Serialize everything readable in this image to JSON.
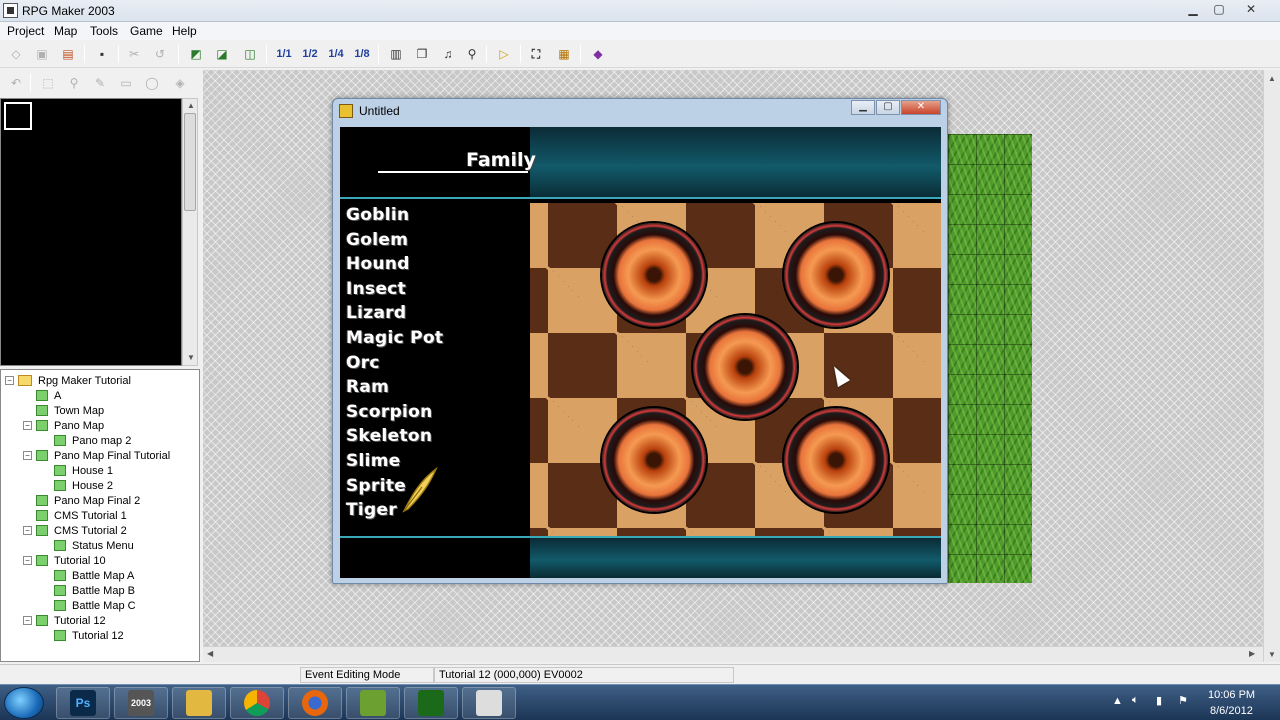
{
  "window": {
    "title": "RPG Maker 2003",
    "minimize": "▁",
    "maximize": "▢",
    "close": "✕"
  },
  "menu": [
    {
      "label": "Project",
      "key": "P"
    },
    {
      "label": "Map",
      "key": "M"
    },
    {
      "label": "Tools",
      "key": "T"
    },
    {
      "label": "Game",
      "key": "G"
    },
    {
      "label": "Help",
      "key": "H"
    }
  ],
  "toolbar": {
    "zoom": [
      "1/1",
      "1/2",
      "1/4",
      "1/8"
    ]
  },
  "map_tree": [
    {
      "label": "Rpg Maker Tutorial",
      "indent": 0,
      "type": "folder",
      "toggle": "−"
    },
    {
      "label": "A",
      "indent": 1,
      "type": "map",
      "toggle": ""
    },
    {
      "label": "Town Map",
      "indent": 1,
      "type": "map",
      "toggle": ""
    },
    {
      "label": "Pano Map",
      "indent": 1,
      "type": "map",
      "toggle": "−"
    },
    {
      "label": "Pano map 2",
      "indent": 2,
      "type": "map",
      "toggle": ""
    },
    {
      "label": "Pano Map Final Tutorial",
      "indent": 1,
      "type": "map",
      "toggle": "−"
    },
    {
      "label": "House 1",
      "indent": 2,
      "type": "map",
      "toggle": ""
    },
    {
      "label": "House 2",
      "indent": 2,
      "type": "map",
      "toggle": ""
    },
    {
      "label": "Pano Map Final 2",
      "indent": 1,
      "type": "map",
      "toggle": ""
    },
    {
      "label": "CMS Tutorial 1",
      "indent": 1,
      "type": "map",
      "toggle": ""
    },
    {
      "label": "CMS Tutorial 2",
      "indent": 1,
      "type": "map",
      "toggle": "−"
    },
    {
      "label": "Status Menu",
      "indent": 2,
      "type": "map",
      "toggle": ""
    },
    {
      "label": "Tutorial 10",
      "indent": 1,
      "type": "map",
      "toggle": "−"
    },
    {
      "label": "Battle Map A",
      "indent": 2,
      "type": "map",
      "toggle": ""
    },
    {
      "label": "Battle Map B",
      "indent": 2,
      "type": "map",
      "toggle": ""
    },
    {
      "label": "Battle Map C",
      "indent": 2,
      "type": "map",
      "toggle": ""
    },
    {
      "label": "Tutorial 12",
      "indent": 1,
      "type": "map",
      "toggle": "−"
    },
    {
      "label": "Tutorial 12",
      "indent": 2,
      "type": "map",
      "toggle": ""
    }
  ],
  "game_window": {
    "title": "Untitled",
    "header": "Family",
    "monsters": [
      "Goblin",
      "Golem",
      "Hound",
      "Insect",
      "Lizard",
      "Magic Pot",
      "Orc",
      "Ram",
      "Scorpion",
      "Skeleton",
      "Slime",
      "Sprite",
      "Tiger"
    ]
  },
  "status": {
    "mode": "Event Editing Mode",
    "map_info": "Tutorial 12 (000,000) EV0002"
  },
  "taskbar": {
    "apps": [
      {
        "name": "photoshop-icon",
        "label": "Ps"
      },
      {
        "name": "rpgmaker-icon",
        "label": "2003"
      },
      {
        "name": "folder-icon",
        "label": ""
      },
      {
        "name": "chrome-icon",
        "label": ""
      },
      {
        "name": "firefox-icon",
        "label": ""
      },
      {
        "name": "notes-icon",
        "label": ""
      },
      {
        "name": "camcorder-icon",
        "label": ""
      },
      {
        "name": "game-character-icon",
        "label": ""
      }
    ],
    "time": "10:06 PM",
    "date": "8/6/2012"
  },
  "colors": {
    "accent": "#125a6a",
    "board_light": "#d9a163",
    "board_dark": "#5a2e16",
    "grass": "#4f9c2c"
  }
}
